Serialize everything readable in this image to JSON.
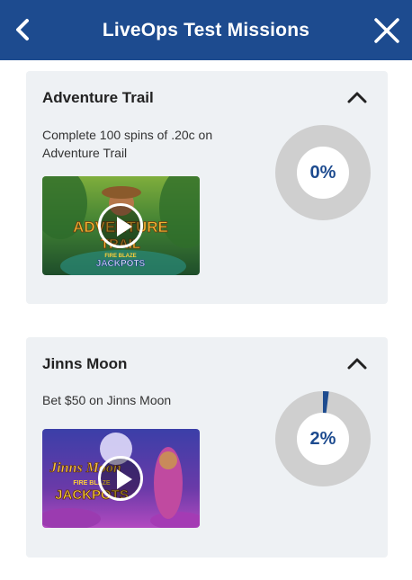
{
  "header": {
    "title": "LiveOps Test Missions",
    "back_icon": "chevron-left-icon",
    "close_icon": "close-icon",
    "color": "#1d4b8f"
  },
  "missions": [
    {
      "title": "Adventure Trail",
      "description": "Complete 100 spins of .20c on Adventure Trail",
      "progress_label": "0%",
      "progress": 0,
      "thumbnail_logo_line1": "ADVENTURE",
      "thumbnail_logo_line2": "TRAIL",
      "thumbnail_badge_line1": "FIRE BLAZE",
      "thumbnail_badge_line2": "JACKPOTS"
    },
    {
      "title": "Jinns Moon",
      "description": "Bet $50 on Jinns Moon",
      "progress_label": "2%",
      "progress": 0.02,
      "thumbnail_logo_line1": "Jinns Moon",
      "thumbnail_badge_line1": "FIRE BLAZE",
      "thumbnail_badge_line2": "JACKPOTS"
    }
  ],
  "colors": {
    "gauge_track": "#cfcfcf",
    "gauge_fill": "#1d4b8f"
  }
}
